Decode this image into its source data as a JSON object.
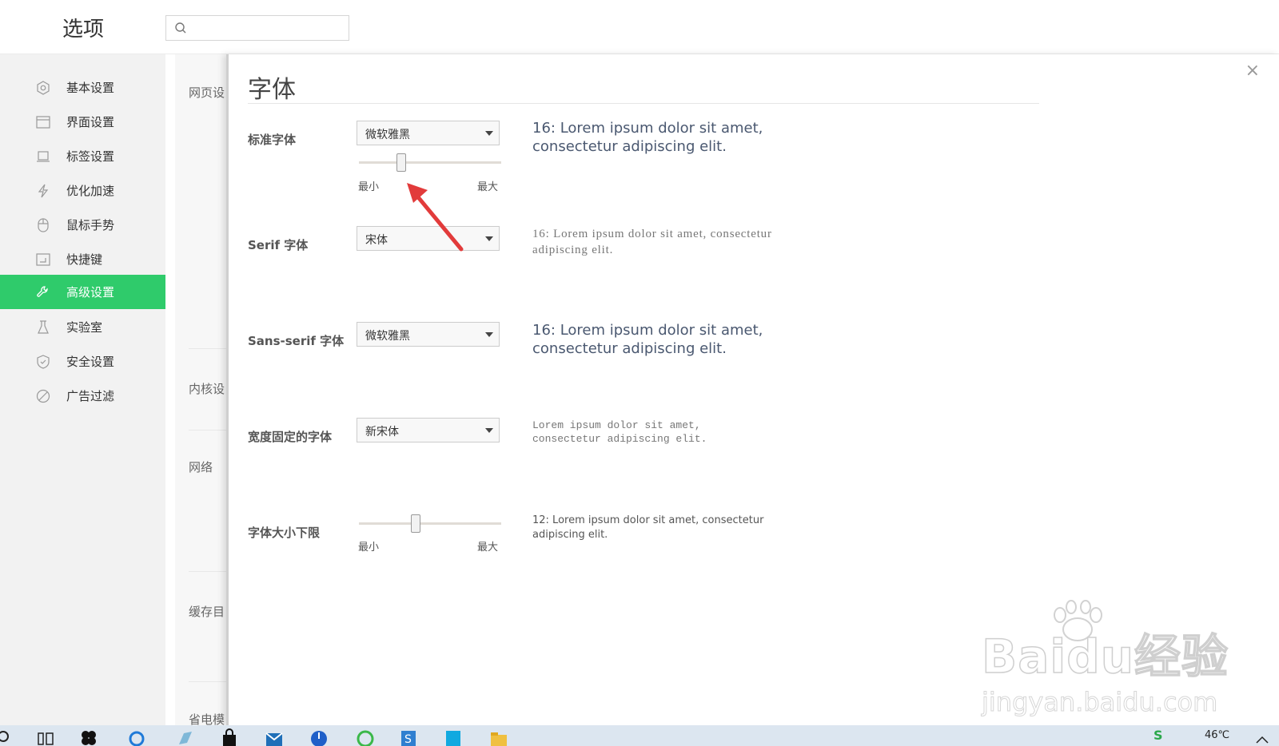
{
  "header": {
    "title": "选项",
    "search_placeholder": ""
  },
  "sidebar": {
    "accent_color": "#2fcb6b",
    "items": [
      {
        "label": "基本设置",
        "icon": "gear-icon"
      },
      {
        "label": "界面设置",
        "icon": "window-icon"
      },
      {
        "label": "标签设置",
        "icon": "tab-icon"
      },
      {
        "label": "优化加速",
        "icon": "lightning-icon"
      },
      {
        "label": "鼠标手势",
        "icon": "mouse-icon"
      },
      {
        "label": "快捷键",
        "icon": "keyboard-icon"
      },
      {
        "label": "高级设置",
        "icon": "wrench-icon",
        "active": true
      },
      {
        "label": "实验室",
        "icon": "flask-icon"
      },
      {
        "label": "安全设置",
        "icon": "shield-icon"
      },
      {
        "label": "广告过滤",
        "icon": "block-icon"
      }
    ]
  },
  "background_sections": [
    "网页设",
    "内核设",
    "网络",
    "缓存目",
    "省电模"
  ],
  "dialog": {
    "title": "字体",
    "close_label": "×",
    "rows": {
      "standard": {
        "label": "标准字体",
        "font": "微软雅黑",
        "slider_min_label": "最小",
        "slider_max_label": "最大",
        "slider_fraction": 0.3,
        "preview": "16: Lorem ipsum dolor sit amet, consectetur adipiscing elit."
      },
      "serif": {
        "label": "Serif 字体",
        "font": "宋体",
        "preview": "16: Lorem ipsum dolor sit amet, consectetur adipiscing elit."
      },
      "sans_serif": {
        "label": "Sans-serif 字体",
        "font": "微软雅黑",
        "preview": "16: Lorem ipsum dolor sit amet, consectetur adipiscing elit."
      },
      "fixed_width": {
        "label": "宽度固定的字体",
        "font": "新宋体",
        "preview": "Lorem ipsum dolor sit amet, consectetur adipiscing elit."
      },
      "min_size": {
        "label": "字体大小下限",
        "slider_min_label": "最小",
        "slider_max_label": "最大",
        "slider_fraction": 0.4,
        "preview": "12: Lorem ipsum dolor sit amet, consectetur adipiscing elit."
      }
    }
  },
  "watermark": {
    "brand": "Baidu经验",
    "url": "jingyan.baidu.com"
  },
  "taskbar": {
    "temperature": "46℃"
  }
}
